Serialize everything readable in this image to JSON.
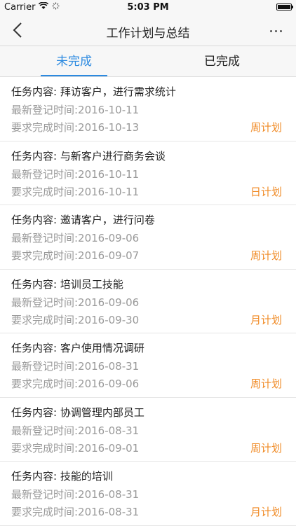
{
  "status_bar": {
    "carrier": "Carrier",
    "time": "5:03 PM"
  },
  "nav": {
    "title": "工作计划与总结"
  },
  "tabs": [
    {
      "label": "未完成",
      "active": true
    },
    {
      "label": "已完成",
      "active": false
    }
  ],
  "items": [
    {
      "content": "任务内容: 拜访客户，进行需求统计",
      "registered": "最新登记时间:2016-10-11",
      "due": "要求完成时间:2016-10-13",
      "plan": "周计划"
    },
    {
      "content": "任务内容: 与新客户进行商务会谈",
      "registered": "最新登记时间:2016-10-11",
      "due": "要求完成时间:2016-10-11",
      "plan": "日计划"
    },
    {
      "content": "任务内容: 邀请客户，进行问卷",
      "registered": "最新登记时间:2016-09-06",
      "due": "要求完成时间:2016-09-07",
      "plan": "周计划"
    },
    {
      "content": "任务内容: 培训员工技能",
      "registered": "最新登记时间:2016-09-06",
      "due": "要求完成时间:2016-09-30",
      "plan": "月计划"
    },
    {
      "content": "任务内容: 客户使用情况调研",
      "registered": "最新登记时间:2016-08-31",
      "due": "要求完成时间:2016-09-06",
      "plan": "周计划"
    },
    {
      "content": "任务内容: 协调管理内部员工",
      "registered": "最新登记时间:2016-08-31",
      "due": "要求完成时间:2016-09-01",
      "plan": "周计划"
    },
    {
      "content": "任务内容: 技能的培训",
      "registered": "最新登记时间:2016-08-31",
      "due": "要求完成时间:2016-08-31",
      "plan": "月计划"
    }
  ],
  "colors": {
    "accent": "#2c8ae0",
    "plan": "#f08a24"
  }
}
